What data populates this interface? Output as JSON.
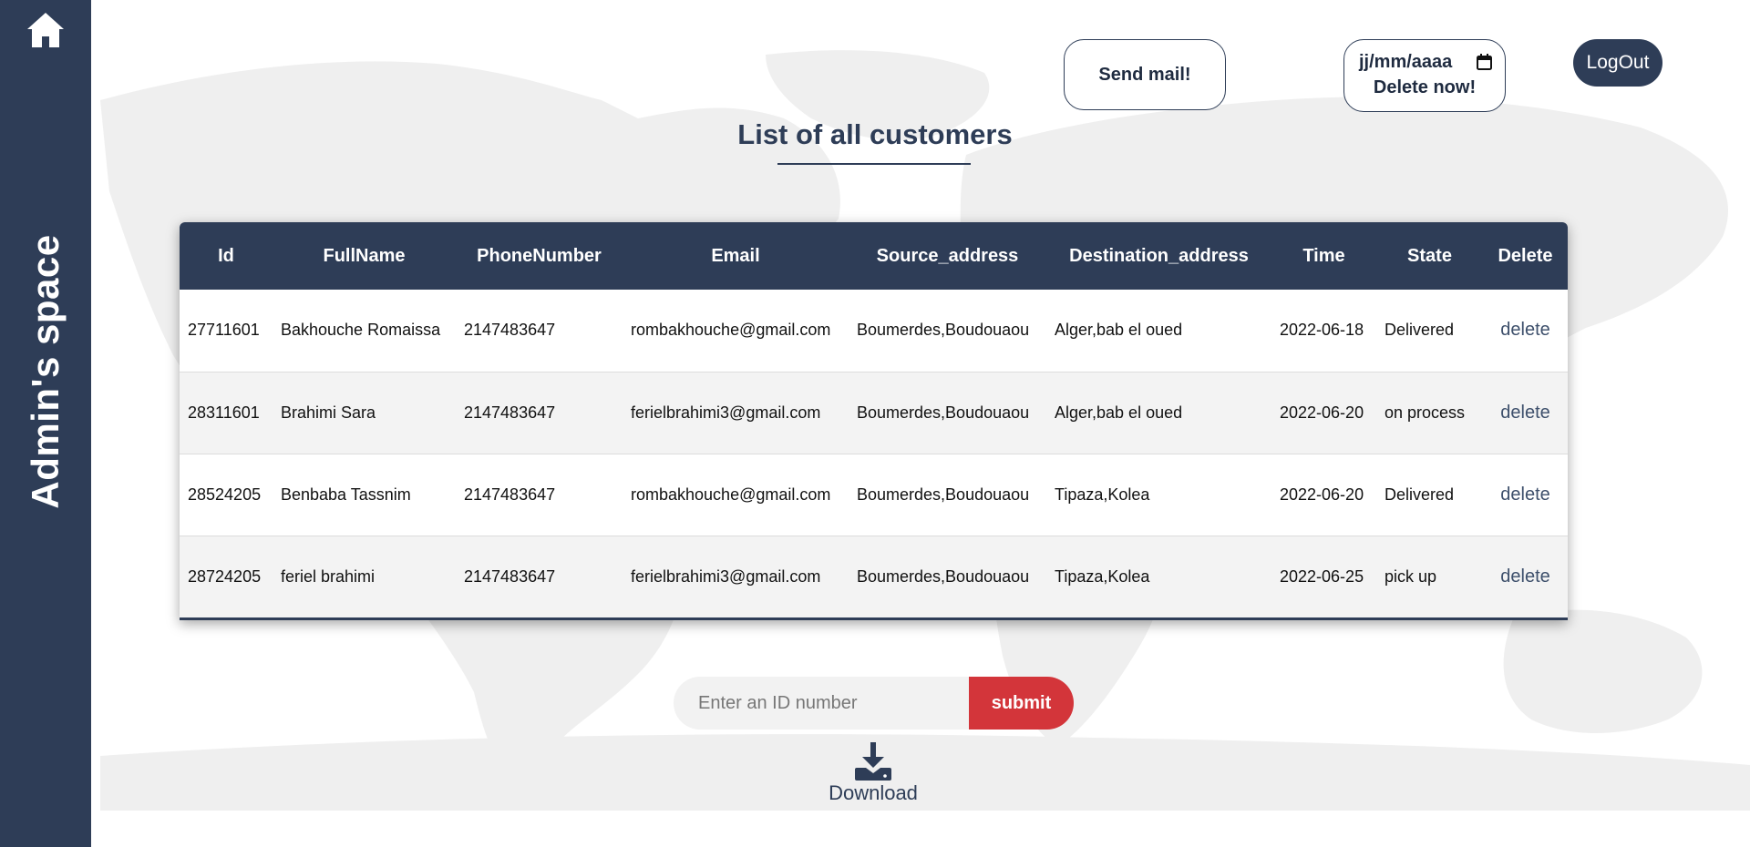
{
  "sidebar": {
    "home_icon": "home-icon",
    "title": "Admin's space"
  },
  "header": {
    "send_mail_label": "Send mail!",
    "date_placeholder": "jj/mm/aaaa",
    "calendar_icon": "calendar-icon",
    "delete_now_label": "Delete now!",
    "logout_label": "LogOut"
  },
  "main": {
    "title": "List of all customers"
  },
  "table": {
    "columns": [
      "Id",
      "FullName",
      "PhoneNumber",
      "Email",
      "Source_address",
      "Destination_address",
      "Time",
      "State",
      "Delete"
    ],
    "rows": [
      {
        "id": "27711601",
        "fullname": "Bakhouche Romaissa",
        "phone": "2147483647",
        "email": "rombakhouche@gmail.com",
        "source": "Boumerdes,Boudouaou",
        "destination": "Alger,bab el oued",
        "time": "2022-06-18",
        "state": "Delivered",
        "delete": "delete"
      },
      {
        "id": "28311601",
        "fullname": "Brahimi Sara",
        "phone": "2147483647",
        "email": "ferielbrahimi3@gmail.com",
        "source": "Boumerdes,Boudouaou",
        "destination": "Alger,bab el oued",
        "time": "2022-06-20",
        "state": "on process",
        "delete": "delete"
      },
      {
        "id": "28524205",
        "fullname": "Benbaba Tassnim",
        "phone": "2147483647",
        "email": "rombakhouche@gmail.com",
        "source": "Boumerdes,Boudouaou",
        "destination": "Tipaza,Kolea",
        "time": "2022-06-20",
        "state": "Delivered",
        "delete": "delete"
      },
      {
        "id": "28724205",
        "fullname": "feriel brahimi",
        "phone": "2147483647",
        "email": "ferielbrahimi3@gmail.com",
        "source": "Boumerdes,Boudouaou",
        "destination": "Tipaza,Kolea",
        "time": "2022-06-25",
        "state": "pick up",
        "delete": "delete"
      }
    ]
  },
  "search": {
    "placeholder": "Enter an ID number",
    "value": "",
    "submit_label": "submit"
  },
  "download": {
    "icon": "download-icon",
    "label": "Download"
  },
  "colors": {
    "primary": "#2e3d57",
    "submit": "#d3353a",
    "map": "#efefef"
  }
}
